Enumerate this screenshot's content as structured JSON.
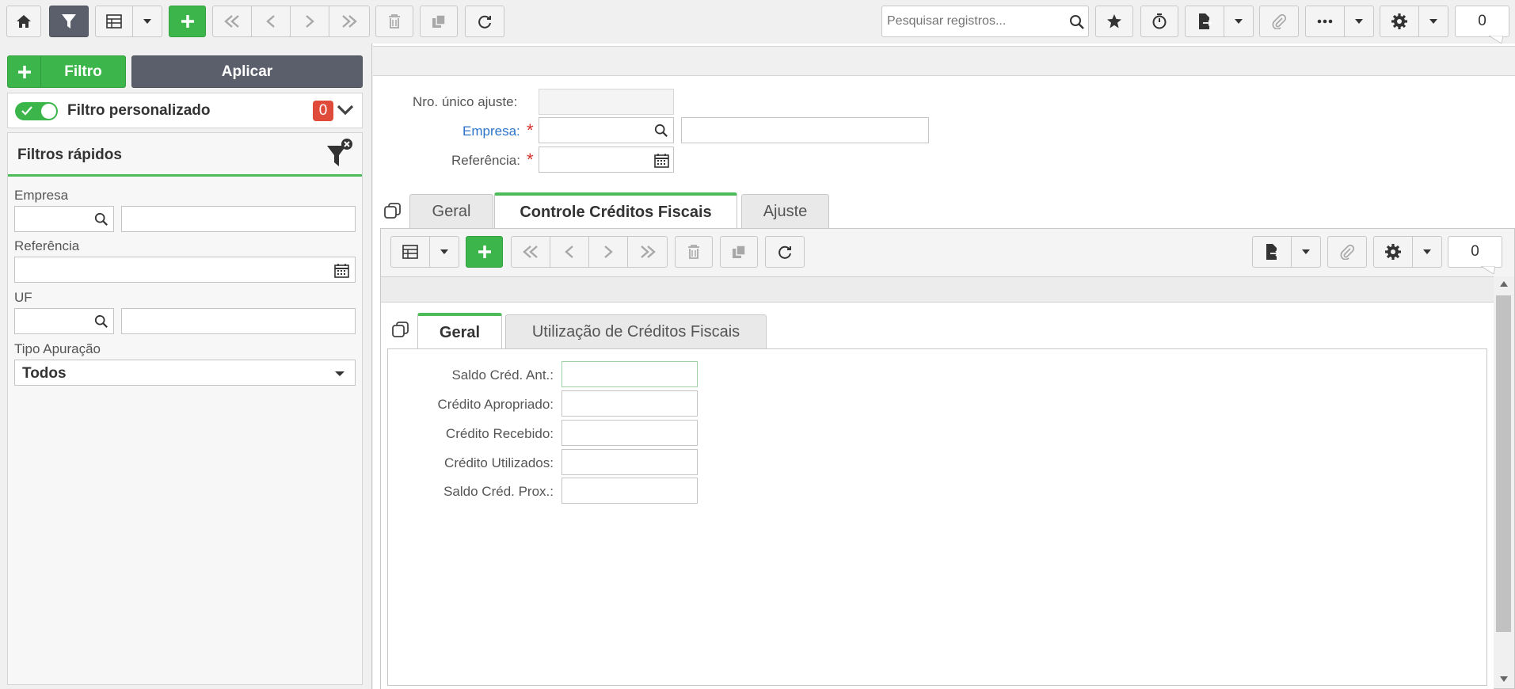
{
  "toolbar": {
    "search_placeholder": "Pesquisar registros...",
    "counter": "0"
  },
  "filter_panel": {
    "add_filter_label": "Filtro",
    "apply_label": "Aplicar",
    "custom_filter_label": "Filtro personalizado",
    "custom_filter_count": "0",
    "quick_filters_title": "Filtros rápidos",
    "fields": {
      "empresa_label": "Empresa",
      "referencia_label": "Referência",
      "uf_label": "UF",
      "tipo_apuracao_label": "Tipo Apuração",
      "tipo_apuracao_value": "Todos"
    }
  },
  "form": {
    "nro_unico_label": "Nro. único ajuste:",
    "empresa_label": "Empresa:",
    "referencia_label": "Referência:",
    "required_mark": "*"
  },
  "tabs": [
    {
      "label": "Geral"
    },
    {
      "label": "Controle Créditos Fiscais"
    },
    {
      "label": "Ajuste"
    }
  ],
  "sub_toolbar": {
    "counter": "0"
  },
  "sub_tabs": [
    {
      "label": "Geral"
    },
    {
      "label": "Utilização de Créditos Fiscais"
    }
  ],
  "detail_fields": [
    {
      "label": "Saldo Créd. Ant.:"
    },
    {
      "label": "Crédito Apropriado:"
    },
    {
      "label": "Crédito Recebido:"
    },
    {
      "label": "Crédito Utilizados:"
    },
    {
      "label": "Saldo Créd. Prox.:"
    }
  ],
  "colors": {
    "accent_green": "#3cb64a",
    "dark_button": "#5a5f6b",
    "badge_red": "#e04a3a",
    "link_blue": "#2a73c9",
    "required_red": "#d9302a"
  }
}
